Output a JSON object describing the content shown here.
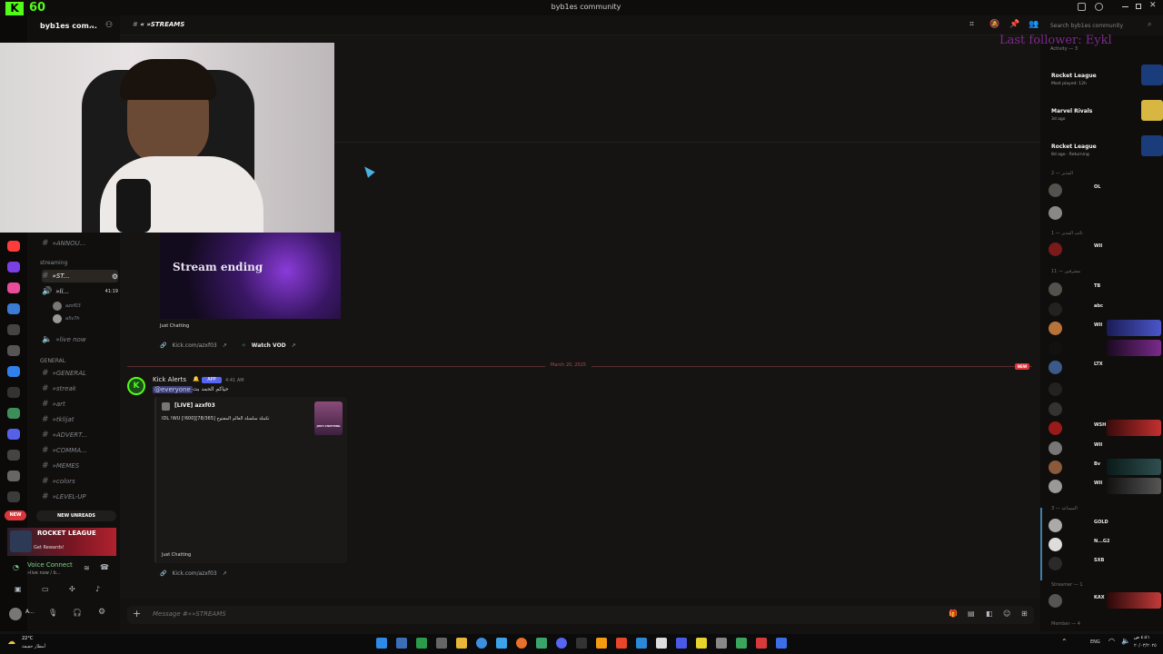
{
  "overlay": {
    "kick_count": "60",
    "last_follower": "Last follower: Eykl"
  },
  "window": {
    "title": "byb1es community"
  },
  "server": {
    "name": "byb1es com..."
  },
  "channel": {
    "name": "»STREAMS",
    "prefix": "«"
  },
  "search": {
    "placeholder": "Search byb1es community"
  },
  "sidebar": {
    "channels_top": [
      {
        "label": "»ANNOU..."
      },
      {
        "label": "»ST..."
      },
      {
        "label": "»li...",
        "count": "41:19"
      },
      {
        "label": "azxf03"
      },
      {
        "label": "a5v7h"
      },
      {
        "label": "»live now"
      }
    ],
    "category_streaming": "streaming",
    "category_general": "GENERAL",
    "channels_general": [
      {
        "label": "»GENERAL"
      },
      {
        "label": "»streak"
      },
      {
        "label": "»art"
      },
      {
        "label": "»tklijat"
      },
      {
        "label": "»ADVERT..."
      },
      {
        "label": "»COMMA..."
      },
      {
        "label": "»MEMES"
      },
      {
        "label": "»colors"
      },
      {
        "label": "»LEVEL-UP"
      }
    ],
    "new_badge": "NEW",
    "new_unreads": "NEW UNREADS",
    "rl_banner": {
      "title": "ROCKET LEAGUE",
      "subtitle": "Get Rewards!"
    },
    "voice": {
      "status": "Voice Connect",
      "sub": "»live now / b..."
    },
    "user": {
      "name": "A..."
    }
  },
  "messages": {
    "embed1": {
      "image_text": "Stream ending",
      "category": "Just Chatting",
      "link": "Kick.com/azxf03",
      "vod": "Watch VOD"
    },
    "date_divider": "March 20, 2025",
    "new_tag": "NEW",
    "message2": {
      "author": "Kick Alerts",
      "app_badge": "APP",
      "time": "4:41 AM",
      "mention": "@everyone",
      "text": "حياكم الحمد بث",
      "embed_title": "[LIVE] azxf03",
      "embed_desc": "IDL !WU [!600][78/365] تكملة سلسلة العالم المفتوح",
      "thumb_text": "JUST CHATTING",
      "category": "Just Chatting",
      "link": "Kick.com/azxf03"
    }
  },
  "composer": {
    "placeholder": "Message #«»STREAMS"
  },
  "right_panel": {
    "activity_header": "Activity — 3",
    "activities": [
      {
        "game": "Rocket League",
        "sub": "Most played: 12h"
      },
      {
        "game": "Marvel Rivals",
        "sub": "3d ago"
      },
      {
        "game": "Rocket League",
        "sub": "8d ago · Returning"
      }
    ],
    "groups": [
      {
        "label": "المدير — 2"
      },
      {
        "label": "نائب المدير — 1"
      },
      {
        "label": "مشرفين — 11"
      },
      {
        "label": "المساعد — 3"
      },
      {
        "label": "Streamer — 1"
      },
      {
        "label": "Member — 4"
      }
    ],
    "members": [
      {
        "name": "OL"
      },
      {
        "name": ""
      },
      {
        "name": "WII"
      },
      {
        "name": "TB"
      },
      {
        "name": "abc"
      },
      {
        "name": "WII"
      },
      {
        "name": ""
      },
      {
        "name": "LTX"
      },
      {
        "name": ""
      },
      {
        "name": ""
      },
      {
        "name": "WSH"
      },
      {
        "name": "WII"
      },
      {
        "name": "Bv"
      },
      {
        "name": "WII"
      },
      {
        "name": "GOLD"
      },
      {
        "name": "N...G2"
      },
      {
        "name": "SXB"
      },
      {
        "name": "KAX"
      }
    ]
  },
  "taskbar": {
    "weather_temp": "22°C",
    "weather_desc": "أمطار خفيفة",
    "lang": "ENG",
    "time": "٤:٤١ ص",
    "date": "٢٠/٠٣/٢٠٢٥"
  },
  "colors": {
    "accent": "#5865f2",
    "kick_green": "#53fc18",
    "alert_red": "#da373c"
  }
}
